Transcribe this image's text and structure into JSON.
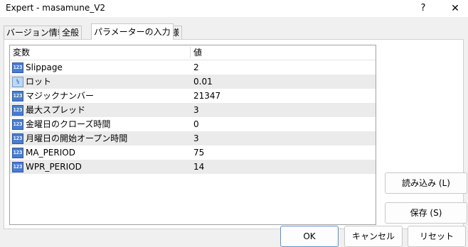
{
  "window": {
    "title": "Expert - masamune_V2",
    "help": "?",
    "close": "✕"
  },
  "tabs": [
    {
      "label": "バージョン情報"
    },
    {
      "label": "全般"
    },
    {
      "label": "パラメーターの入力"
    },
    {
      "label": "仕様"
    }
  ],
  "table": {
    "headers": {
      "variable": "変数",
      "value": "値"
    },
    "rows": [
      {
        "icon": "123",
        "name": "Slippage",
        "value": "2"
      },
      {
        "icon": "½",
        "name": "ロット",
        "value": "0.01"
      },
      {
        "icon": "123",
        "name": "マジックナンバー",
        "value": "21347"
      },
      {
        "icon": "123",
        "name": "最大スプレッド",
        "value": "3"
      },
      {
        "icon": "123",
        "name": "金曜日のクローズ時間",
        "value": "0"
      },
      {
        "icon": "123",
        "name": "月曜日の開始オープン時間",
        "value": "3"
      },
      {
        "icon": "123",
        "name": "MA_PERIOD",
        "value": "75"
      },
      {
        "icon": "123",
        "name": "WPR_PERIOD",
        "value": "14"
      }
    ]
  },
  "buttons": {
    "load": "読み込み (L)",
    "save": "保存 (S)",
    "ok": "OK",
    "cancel": "キャンセル",
    "reset": "リセット"
  }
}
